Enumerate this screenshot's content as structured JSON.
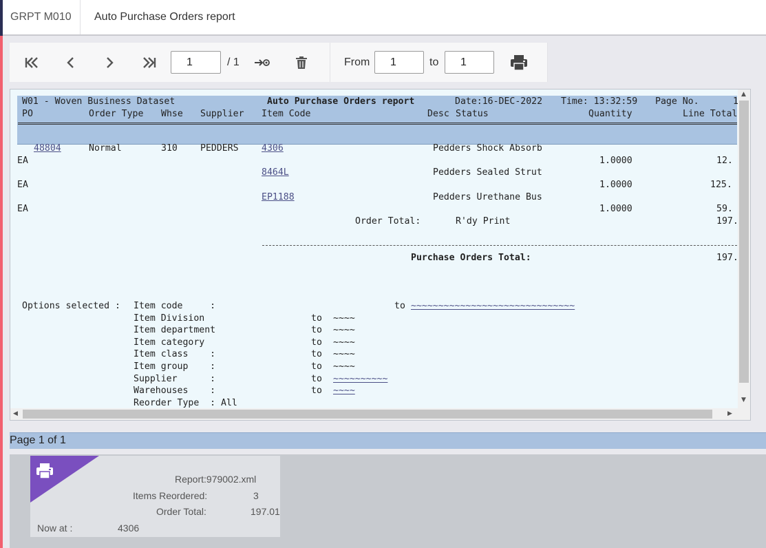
{
  "window": {
    "code": "GRPT M010",
    "title": "Auto Purchase Orders report"
  },
  "toolbar": {
    "page_input": "1",
    "page_total": "/ 1",
    "from_label": "From",
    "from_value": "1",
    "to_label": "to",
    "to_value": "1",
    "icons": [
      "first-page-icon",
      "prev-page-icon",
      "next-page-icon",
      "last-page-icon",
      "goto-page-icon",
      "trash-icon",
      "print-icon"
    ]
  },
  "report": {
    "header": {
      "dataset": "W01 - Woven Business Dataset",
      "title": "Auto Purchase Orders report",
      "date": "Date:16-DEC-2022",
      "time": "Time: 13:32:59",
      "page_no": "Page No.",
      "page_no_value": "1",
      "columns": {
        "po": "PO",
        "order_type": "Order Type",
        "whse": "Whse",
        "supplier": "Supplier",
        "item_code": "Item Code",
        "desc": "Desc",
        "status": "Status",
        "quantity": "Quantity",
        "line_total": "Line Total"
      }
    },
    "order": {
      "po": "48804",
      "order_type": "Normal",
      "whse": "310",
      "supplier": "PEDDERS",
      "lines": [
        {
          "item_code": "4306",
          "desc": "Pedders Shock Absorb",
          "uom": "EA",
          "quantity": "1.0000",
          "line_total": "12."
        },
        {
          "item_code": "8464L",
          "desc": "Pedders Sealed Strut",
          "uom": "EA",
          "quantity": "1.0000",
          "line_total": "125."
        },
        {
          "item_code": "EP1188",
          "desc": "Pedders Urethane Bus",
          "uom": "EA",
          "quantity": "1.0000",
          "line_total": "59."
        }
      ],
      "order_total_label": "Order Total:",
      "order_status": "R'dy Print",
      "order_total": "197."
    },
    "grand_total_label": "Purchase Orders Total:",
    "grand_total": "197.",
    "options": {
      "heading": "Options selected :",
      "rows": [
        {
          "label": "Item code     :",
          "to": "to",
          "value": "~~~~~~~~~~~~~~~~~~~~~~~~~~~~~~"
        },
        {
          "label": "Item Division",
          "to": "to",
          "value": "~~~~"
        },
        {
          "label": "Item department",
          "to": "to",
          "value": "~~~~"
        },
        {
          "label": "Item category",
          "to": "to",
          "value": "~~~~"
        },
        {
          "label": "Item class    :",
          "to": "to",
          "value": "~~~~"
        },
        {
          "label": "Item group    :",
          "to": "to",
          "value": "~~~~"
        },
        {
          "label": "Supplier      :",
          "to": "to",
          "value": "~~~~~~~~~~"
        },
        {
          "label": "Warehouses    :",
          "to": "to",
          "value": "~~~~"
        },
        {
          "label": "Reorder Type  : All",
          "to": "",
          "value": ""
        }
      ]
    }
  },
  "pagebar": {
    "text": "Page 1 of 1"
  },
  "status": {
    "report": "Report:979002.xml",
    "items_reordered_label": "Items Reordered:",
    "items_reordered_value": "3",
    "order_total_label": "Order Total:",
    "order_total_value": "197.01",
    "now_at_label": "Now at :",
    "now_at_value": "4306"
  },
  "colors": {
    "accent_left": "#f2606f",
    "header_band": "#a9c3e1",
    "status_triangle": "#7a4fbf"
  }
}
